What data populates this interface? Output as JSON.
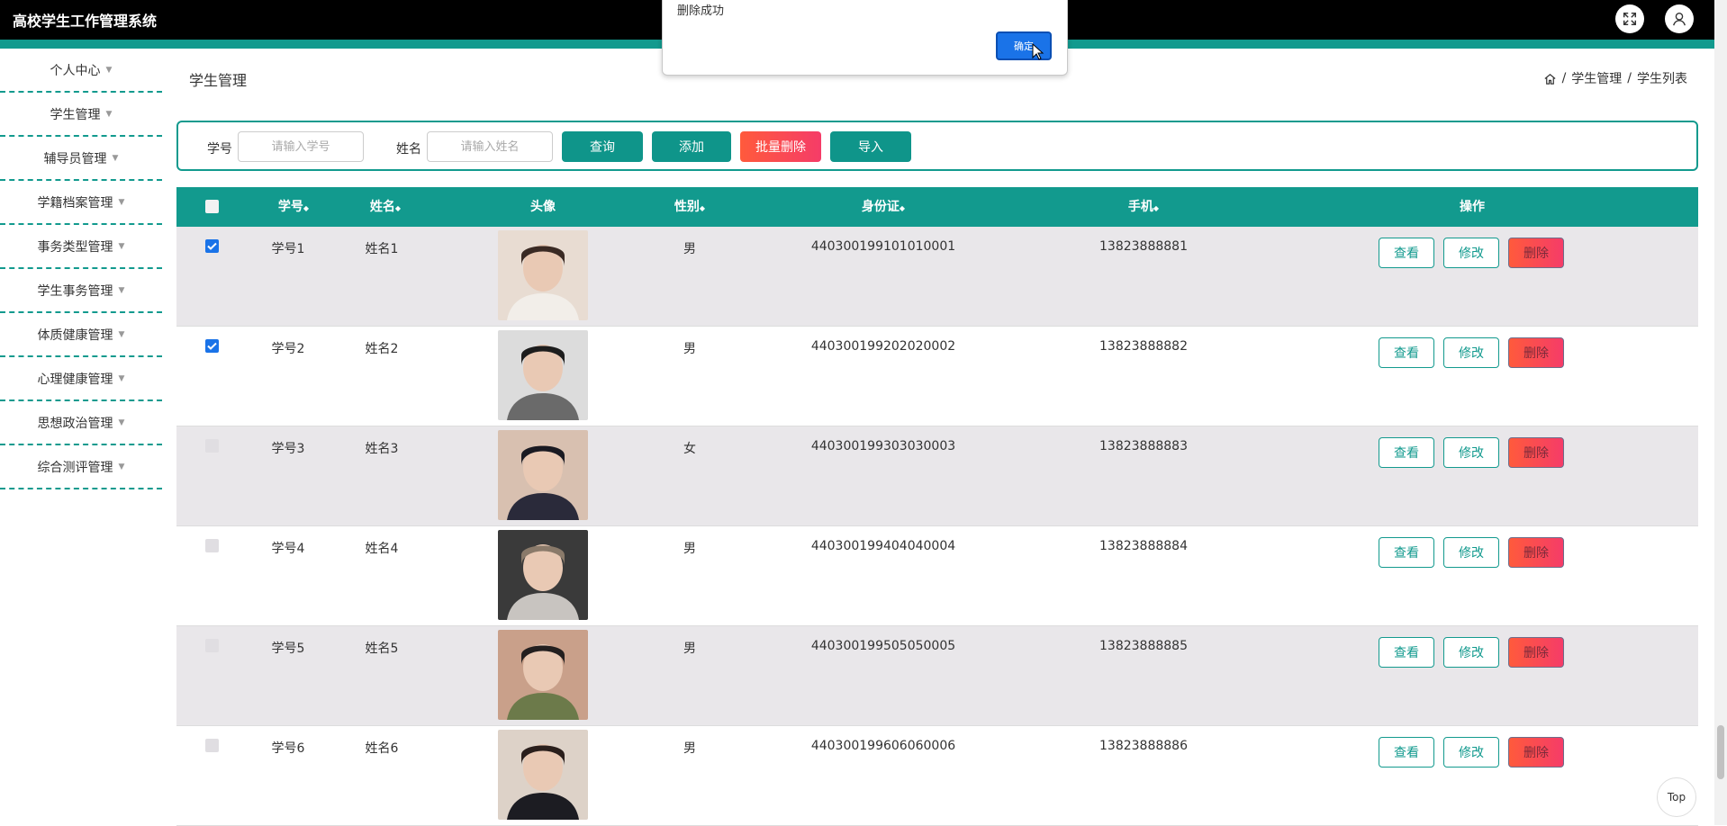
{
  "header": {
    "title": "高校学生工作管理系统"
  },
  "sidebar": {
    "items": [
      {
        "label": "个人中心"
      },
      {
        "label": "学生管理"
      },
      {
        "label": "辅导员管理"
      },
      {
        "label": "学籍档案管理"
      },
      {
        "label": "事务类型管理"
      },
      {
        "label": "学生事务管理"
      },
      {
        "label": "体质健康管理"
      },
      {
        "label": "心理健康管理"
      },
      {
        "label": "思想政治管理"
      },
      {
        "label": "综合测评管理"
      }
    ]
  },
  "page": {
    "title": "学生管理",
    "breadcrumb": [
      "学生管理",
      "学生列表"
    ],
    "breadcrumb_sep": "/"
  },
  "search": {
    "id_label": "学号",
    "id_placeholder": "请输入学号",
    "name_label": "姓名",
    "name_placeholder": "请输入姓名",
    "query_btn": "查询",
    "add_btn": "添加",
    "batch_delete_btn": "批量删除",
    "import_btn": "导入"
  },
  "table": {
    "headers": [
      "学号",
      "姓名",
      "头像",
      "性别",
      "身份证",
      "手机",
      "操作"
    ],
    "sort_glyph": "◆",
    "rows": [
      {
        "id": "学号1",
        "name": "姓名1",
        "gender": "男",
        "idcard": "440300199101010001",
        "phone": "13823888881",
        "checked": true
      },
      {
        "id": "学号2",
        "name": "姓名2",
        "gender": "男",
        "idcard": "440300199202020002",
        "phone": "13823888882",
        "checked": true
      },
      {
        "id": "学号3",
        "name": "姓名3",
        "gender": "女",
        "idcard": "440300199303030003",
        "phone": "13823888883",
        "checked": false
      },
      {
        "id": "学号4",
        "name": "姓名4",
        "gender": "男",
        "idcard": "440300199404040004",
        "phone": "13823888884",
        "checked": false
      },
      {
        "id": "学号5",
        "name": "姓名5",
        "gender": "男",
        "idcard": "440300199505050005",
        "phone": "13823888885",
        "checked": false
      },
      {
        "id": "学号6",
        "name": "姓名6",
        "gender": "男",
        "idcard": "440300199606060006",
        "phone": "13823888886",
        "checked": false
      }
    ],
    "actions": {
      "view": "查看",
      "edit": "修改",
      "delete": "删除"
    }
  },
  "alert": {
    "message": "删除成功",
    "ok": "确定"
  },
  "top_button": "Top",
  "colors": {
    "accent": "#129a8e",
    "danger": "#f53c68",
    "checkbox": "#1a73e8",
    "topbar": "#000000"
  }
}
